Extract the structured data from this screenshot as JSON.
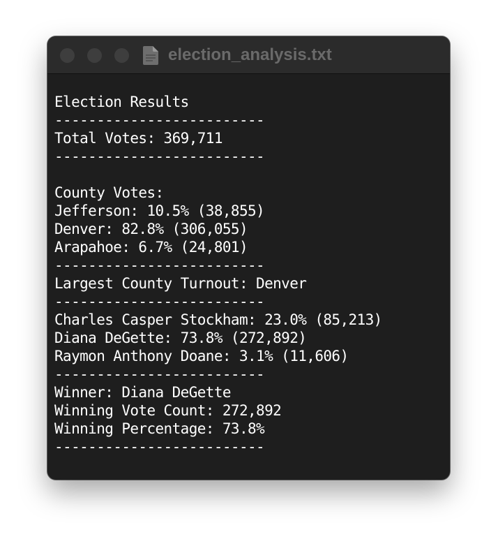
{
  "window": {
    "title": "election_analysis.txt",
    "icon": "document-icon"
  },
  "lines": [
    "Election Results",
    "-------------------------",
    "Total Votes: 369,711",
    "-------------------------",
    "",
    "County Votes:",
    "Jefferson: 10.5% (38,855)",
    "Denver: 82.8% (306,055)",
    "Arapahoe: 6.7% (24,801)",
    "-------------------------",
    "Largest County Turnout: Denver",
    "-------------------------",
    "Charles Casper Stockham: 23.0% (85,213)",
    "Diana DeGette: 73.8% (272,892)",
    "Raymon Anthony Doane: 3.1% (11,606)",
    "-------------------------",
    "Winner: Diana DeGette",
    "Winning Vote Count: 272,892",
    "Winning Percentage: 73.8%",
    "-------------------------"
  ],
  "colors": {
    "background": "#1e1e1e",
    "titlebar": "#2b2b2b",
    "text": "#ffffff",
    "title_text": "#6a6a6a",
    "traffic_light": "#3e3e3e"
  }
}
